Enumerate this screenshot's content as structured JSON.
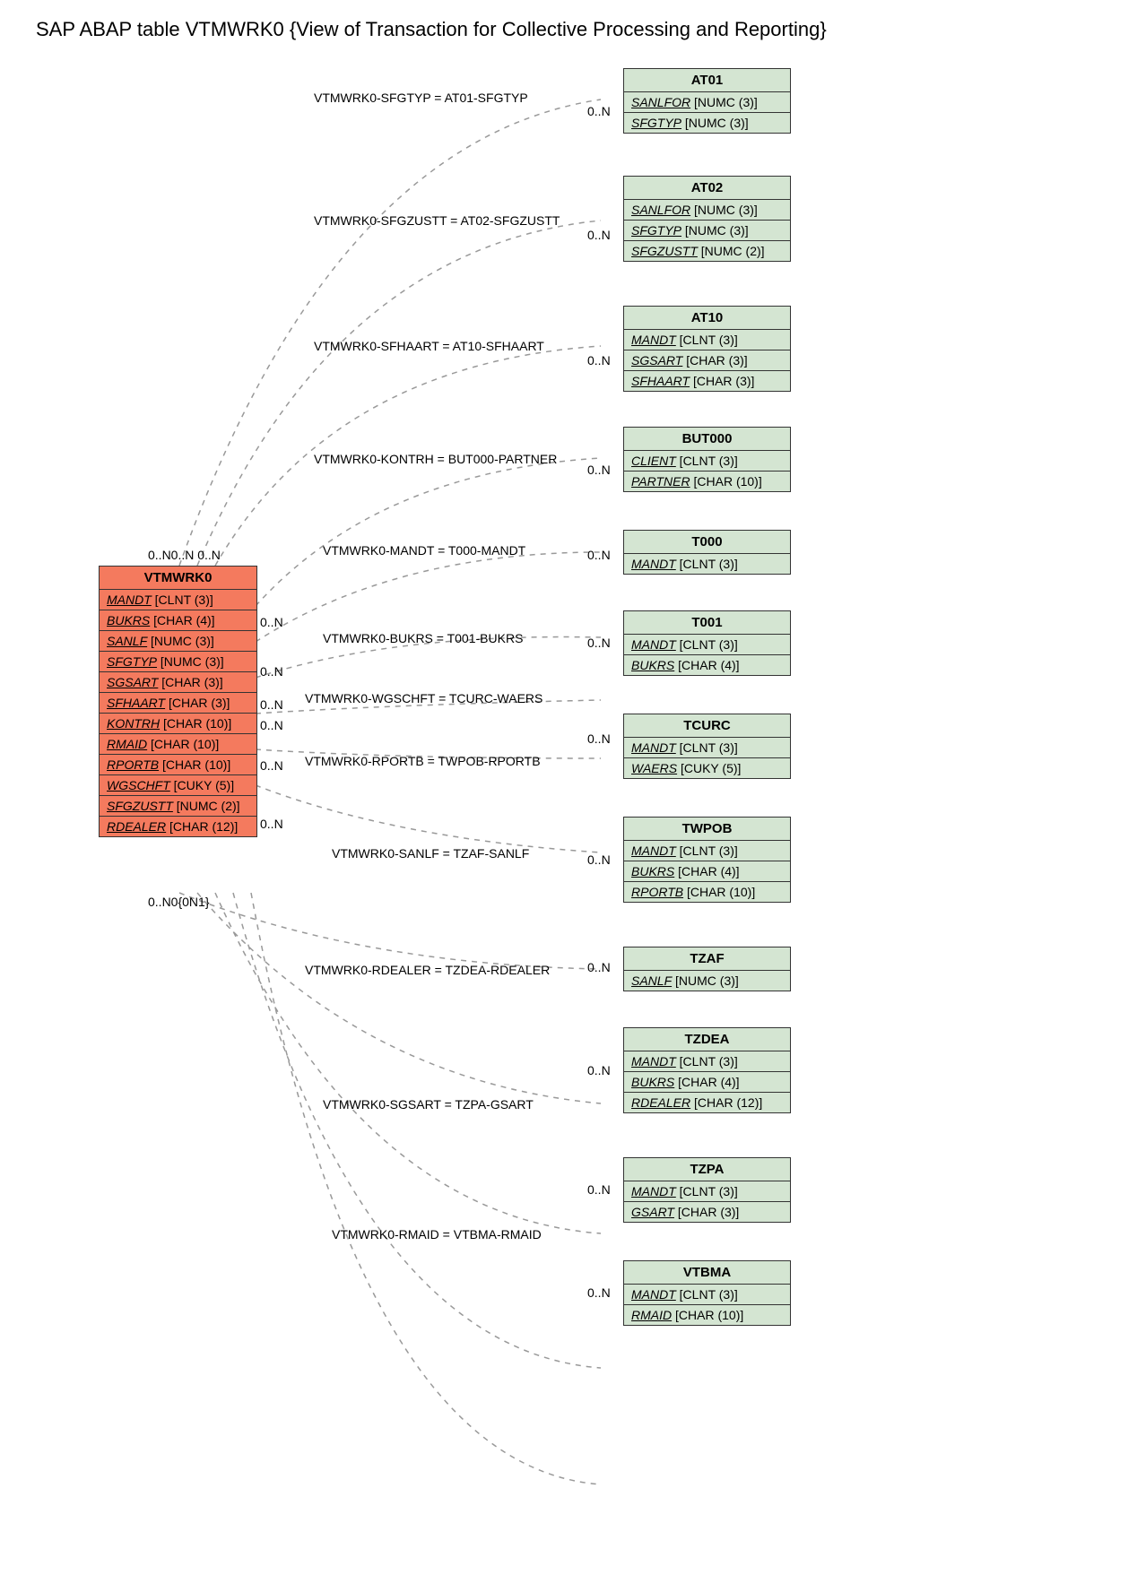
{
  "title": "SAP ABAP table VTMWRK0 {View of Transaction for Collective Processing and Reporting}",
  "main_entity": {
    "name": "VTMWRK0",
    "fields": [
      {
        "name": "MANDT",
        "type": "[CLNT (3)]"
      },
      {
        "name": "BUKRS",
        "type": "[CHAR (4)]"
      },
      {
        "name": "SANLF",
        "type": "[NUMC (3)]"
      },
      {
        "name": "SFGTYP",
        "type": "[NUMC (3)]"
      },
      {
        "name": "SGSART",
        "type": "[CHAR (3)]"
      },
      {
        "name": "SFHAART",
        "type": "[CHAR (3)]"
      },
      {
        "name": "KONTRH",
        "type": "[CHAR (10)]"
      },
      {
        "name": "RMAID",
        "type": "[CHAR (10)]"
      },
      {
        "name": "RPORTB",
        "type": "[CHAR (10)]"
      },
      {
        "name": "WGSCHFT",
        "type": "[CUKY (5)]"
      },
      {
        "name": "SFGZUSTT",
        "type": "[NUMC (2)]"
      },
      {
        "name": "RDEALER",
        "type": "[CHAR (12)]"
      }
    ]
  },
  "related": [
    {
      "name": "AT01",
      "fields": [
        {
          "name": "SANLFOR",
          "type": "[NUMC (3)]"
        },
        {
          "name": "SFGTYP",
          "type": "[NUMC (3)]"
        }
      ]
    },
    {
      "name": "AT02",
      "fields": [
        {
          "name": "SANLFOR",
          "type": "[NUMC (3)]"
        },
        {
          "name": "SFGTYP",
          "type": "[NUMC (3)]"
        },
        {
          "name": "SFGZUSTT",
          "type": "[NUMC (2)]"
        }
      ]
    },
    {
      "name": "AT10",
      "fields": [
        {
          "name": "MANDT",
          "type": "[CLNT (3)]"
        },
        {
          "name": "SGSART",
          "type": "[CHAR (3)]"
        },
        {
          "name": "SFHAART",
          "type": "[CHAR (3)]"
        }
      ]
    },
    {
      "name": "BUT000",
      "fields": [
        {
          "name": "CLIENT",
          "type": "[CLNT (3)]"
        },
        {
          "name": "PARTNER",
          "type": "[CHAR (10)]"
        }
      ]
    },
    {
      "name": "T000",
      "fields": [
        {
          "name": "MANDT",
          "type": "[CLNT (3)]"
        }
      ]
    },
    {
      "name": "T001",
      "fields": [
        {
          "name": "MANDT",
          "type": "[CLNT (3)]"
        },
        {
          "name": "BUKRS",
          "type": "[CHAR (4)]"
        }
      ]
    },
    {
      "name": "TCURC",
      "fields": [
        {
          "name": "MANDT",
          "type": "[CLNT (3)]"
        },
        {
          "name": "WAERS",
          "type": "[CUKY (5)]"
        }
      ]
    },
    {
      "name": "TWPOB",
      "fields": [
        {
          "name": "MANDT",
          "type": "[CLNT (3)]"
        },
        {
          "name": "BUKRS",
          "type": "[CHAR (4)]"
        },
        {
          "name": "RPORTB",
          "type": "[CHAR (10)]"
        }
      ]
    },
    {
      "name": "TZAF",
      "fields": [
        {
          "name": "SANLF",
          "type": "[NUMC (3)]"
        }
      ]
    },
    {
      "name": "TZDEA",
      "fields": [
        {
          "name": "MANDT",
          "type": "[CLNT (3)]"
        },
        {
          "name": "BUKRS",
          "type": "[CHAR (4)]"
        },
        {
          "name": "RDEALER",
          "type": "[CHAR (12)]"
        }
      ]
    },
    {
      "name": "TZPA",
      "fields": [
        {
          "name": "MANDT",
          "type": "[CLNT (3)]"
        },
        {
          "name": "GSART",
          "type": "[CHAR (3)]"
        }
      ]
    },
    {
      "name": "VTBMA",
      "fields": [
        {
          "name": "MANDT",
          "type": "[CLNT (3)]"
        },
        {
          "name": "RMAID",
          "type": "[CHAR (10)]"
        }
      ]
    }
  ],
  "relations": [
    {
      "label": "VTMWRK0-SFGTYP = AT01-SFGTYP",
      "card_right": "0..N"
    },
    {
      "label": "VTMWRK0-SFGZUSTT = AT02-SFGZUSTT",
      "card_right": "0..N"
    },
    {
      "label": "VTMWRK0-SFHAART = AT10-SFHAART",
      "card_right": "0..N"
    },
    {
      "label": "VTMWRK0-KONTRH = BUT000-PARTNER",
      "card_right": "0..N"
    },
    {
      "label": "VTMWRK0-MANDT = T000-MANDT",
      "card_right": "0..N"
    },
    {
      "label": "VTMWRK0-BUKRS = T001-BUKRS",
      "card_right": "0..N"
    },
    {
      "label": "VTMWRK0-WGSCHFT = TCURC-WAERS",
      "card_right": "0..N"
    },
    {
      "label": "VTMWRK0-RPORTB = TWPOB-RPORTB",
      "card_right": "0..N"
    },
    {
      "label": "VTMWRK0-SANLF = TZAF-SANLF",
      "card_right": "0..N"
    },
    {
      "label": "VTMWRK0-RDEALER = TZDEA-RDEALER",
      "card_right": "0..N"
    },
    {
      "label": "VTMWRK0-SGSART = TZPA-GSART",
      "card_right": "0..N"
    },
    {
      "label": "VTMWRK0-RMAID = VTBMA-RMAID",
      "card_right": "0..N"
    }
  ],
  "left_cards_top": "0..N0..N 0..N",
  "left_cards_side": [
    "0..N",
    "0..N",
    "0..N",
    "0..N",
    "0..N",
    "0..N"
  ],
  "left_cards_bottom": "0..N0{0N1}",
  "colors": {
    "main": "#f47a5e",
    "related": "#d4e5d2"
  }
}
